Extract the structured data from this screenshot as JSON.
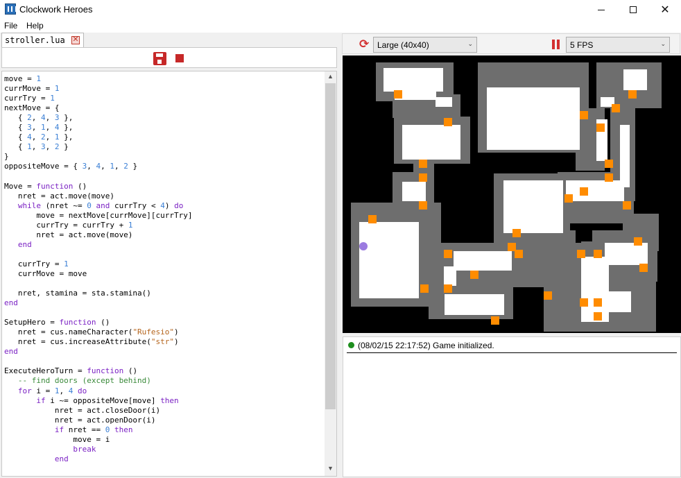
{
  "window": {
    "title": "Clockwork Heroes",
    "minimize": "─",
    "maximize": "☐",
    "close": "✕"
  },
  "menu": {
    "file": "File",
    "help": "Help"
  },
  "editor": {
    "tab_label": "stroller.lua",
    "tab_close": "✕",
    "scroll_up": "▲",
    "scroll_down": "▼",
    "code_lines": [
      [
        [
          "",
          "move = "
        ],
        [
          "num",
          "1"
        ]
      ],
      [
        [
          "",
          "currMove = "
        ],
        [
          "num",
          "1"
        ]
      ],
      [
        [
          "",
          "currTry = "
        ],
        [
          "num",
          "1"
        ]
      ],
      [
        [
          "",
          "nextMove = {"
        ]
      ],
      [
        [
          "",
          "   { "
        ],
        [
          "num",
          "2"
        ],
        [
          "",
          ", "
        ],
        [
          "num",
          "4"
        ],
        [
          "",
          ", "
        ],
        [
          "num",
          "3"
        ],
        [
          "",
          " },"
        ]
      ],
      [
        [
          "",
          "   { "
        ],
        [
          "num",
          "3"
        ],
        [
          "",
          ", "
        ],
        [
          "num",
          "1"
        ],
        [
          "",
          ", "
        ],
        [
          "num",
          "4"
        ],
        [
          "",
          " },"
        ]
      ],
      [
        [
          "",
          "   { "
        ],
        [
          "num",
          "4"
        ],
        [
          "",
          ", "
        ],
        [
          "num",
          "2"
        ],
        [
          "",
          ", "
        ],
        [
          "num",
          "1"
        ],
        [
          "",
          " },"
        ]
      ],
      [
        [
          "",
          "   { "
        ],
        [
          "num",
          "1"
        ],
        [
          "",
          ", "
        ],
        [
          "num",
          "3"
        ],
        [
          "",
          ", "
        ],
        [
          "num",
          "2"
        ],
        [
          "",
          " }"
        ]
      ],
      [
        [
          "",
          "}"
        ]
      ],
      [
        [
          "",
          "oppositeMove = { "
        ],
        [
          "num",
          "3"
        ],
        [
          "",
          ", "
        ],
        [
          "num",
          "4"
        ],
        [
          "",
          ", "
        ],
        [
          "num",
          "1"
        ],
        [
          "",
          ", "
        ],
        [
          "num",
          "2"
        ],
        [
          "",
          " }"
        ]
      ],
      [
        [
          "",
          ""
        ]
      ],
      [
        [
          "",
          "Move = "
        ],
        [
          "kw",
          "function"
        ],
        [
          "",
          " ()"
        ]
      ],
      [
        [
          "",
          "   nret = act.move(move)"
        ]
      ],
      [
        [
          "",
          "   "
        ],
        [
          "kw",
          "while"
        ],
        [
          "",
          " (nret ~= "
        ],
        [
          "num",
          "0"
        ],
        [
          "",
          " "
        ],
        [
          "kw",
          "and"
        ],
        [
          "",
          " currTry < "
        ],
        [
          "num",
          "4"
        ],
        [
          "",
          ") "
        ],
        [
          "kw",
          "do"
        ]
      ],
      [
        [
          "",
          "       move = nextMove[currMove][currTry]"
        ]
      ],
      [
        [
          "",
          "       currTry = currTry + "
        ],
        [
          "num",
          "1"
        ]
      ],
      [
        [
          "",
          "       nret = act.move(move)"
        ]
      ],
      [
        [
          "",
          "   "
        ],
        [
          "kw",
          "end"
        ]
      ],
      [
        [
          "",
          ""
        ]
      ],
      [
        [
          "",
          "   currTry = "
        ],
        [
          "num",
          "1"
        ]
      ],
      [
        [
          "",
          "   currMove = move"
        ]
      ],
      [
        [
          "",
          ""
        ]
      ],
      [
        [
          "",
          "   nret, stamina = sta.stamina()"
        ]
      ],
      [
        [
          "kw",
          "end"
        ]
      ],
      [
        [
          "",
          ""
        ]
      ],
      [
        [
          "",
          "SetupHero = "
        ],
        [
          "kw",
          "function"
        ],
        [
          "",
          " ()"
        ]
      ],
      [
        [
          "",
          "   nret = cus.nameCharacter("
        ],
        [
          "str",
          "\"Rufesio\""
        ],
        [
          "",
          ")"
        ]
      ],
      [
        [
          "",
          "   nret = cus.increaseAttribute("
        ],
        [
          "str",
          "\"str\""
        ],
        [
          "",
          ")"
        ]
      ],
      [
        [
          "kw",
          "end"
        ]
      ],
      [
        [
          "",
          ""
        ]
      ],
      [
        [
          "",
          "ExecuteHeroTurn = "
        ],
        [
          "kw",
          "function"
        ],
        [
          "",
          " ()"
        ]
      ],
      [
        [
          "com",
          "   -- find doors (except behind)"
        ]
      ],
      [
        [
          "",
          "   "
        ],
        [
          "kw",
          "for"
        ],
        [
          "",
          " i = "
        ],
        [
          "num",
          "1"
        ],
        [
          "",
          ", "
        ],
        [
          "num",
          "4"
        ],
        [
          "",
          " "
        ],
        [
          "kw",
          "do"
        ]
      ],
      [
        [
          "",
          "       "
        ],
        [
          "kw",
          "if"
        ],
        [
          "",
          " i ~= oppositeMove[move] "
        ],
        [
          "kw",
          "then"
        ]
      ],
      [
        [
          "",
          "           nret = act.closeDoor(i)"
        ]
      ],
      [
        [
          "",
          "           nret = act.openDoor(i)"
        ]
      ],
      [
        [
          "",
          "           "
        ],
        [
          "kw",
          "if"
        ],
        [
          "",
          " nret == "
        ],
        [
          "num",
          "0"
        ],
        [
          "",
          " "
        ],
        [
          "kw",
          "then"
        ]
      ],
      [
        [
          "",
          "               move = i"
        ]
      ],
      [
        [
          "",
          "               "
        ],
        [
          "kw",
          "break"
        ]
      ],
      [
        [
          "",
          "           "
        ],
        [
          "kw",
          "end"
        ]
      ]
    ]
  },
  "controls": {
    "restart_icon": "⟳",
    "map_size": "Large (40x40)",
    "fps": "5 FPS",
    "select_arrow": "⌄"
  },
  "log": {
    "time": "(08/02/15 22:17:52)",
    "message": "Game initialized."
  },
  "colors": {
    "wall": "#6e6e6e",
    "floor": "#ffffff",
    "door": "#ff8c00",
    "hero": "#9b7be0",
    "void": "#000000"
  },
  "map": {
    "grid": "40x40",
    "hero_present": true,
    "door_count": 33
  }
}
